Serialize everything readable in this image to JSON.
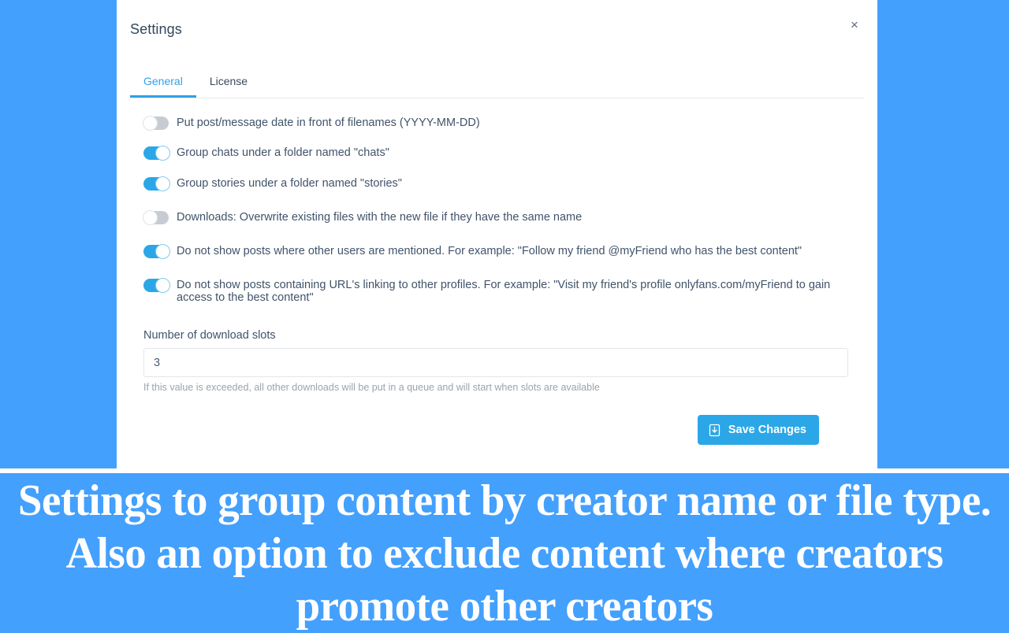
{
  "theme": {
    "accent": "#2ba7e8",
    "page_background": "#44a0fd",
    "modal_background": "#ffffff",
    "text": "#40536a",
    "muted_text": "#9aa4ad"
  },
  "modal": {
    "title": "Settings",
    "close_label": "×",
    "tabs": [
      {
        "label": "General",
        "active": true
      },
      {
        "label": "License",
        "active": false
      }
    ],
    "toggles": [
      {
        "label": "Put post/message date in front of filenames (YYYY-MM-DD)",
        "state": "off"
      },
      {
        "label": "Group chats under a folder named \"chats\"",
        "state": "on"
      },
      {
        "label": "Group stories under a folder named \"stories\"",
        "state": "on"
      },
      {
        "label": "Downloads: Overwrite existing files with the new file if they have the same name",
        "state": "off"
      },
      {
        "label": "Do not show posts where other users are mentioned. For example: \"Follow my friend @myFriend who has the best content\"",
        "state": "on"
      },
      {
        "label": "Do not show posts containing URL's linking to other profiles. For example: \"Visit my friend's profile onlyfans.com/myFriend to gain access to the best content\"",
        "state": "on"
      }
    ],
    "slots_field": {
      "label": "Number of download slots",
      "value": "3",
      "placeholder": "3",
      "hint": "If this value is exceeded, all other downloads will be put in a queue and will start when slots are available"
    },
    "save_button": {
      "label": "Save Changes",
      "icon": "save-icon"
    }
  },
  "caption": {
    "text": "Settings to group content by creator name or file type. Also an option to exclude content where creators promote other creators"
  }
}
